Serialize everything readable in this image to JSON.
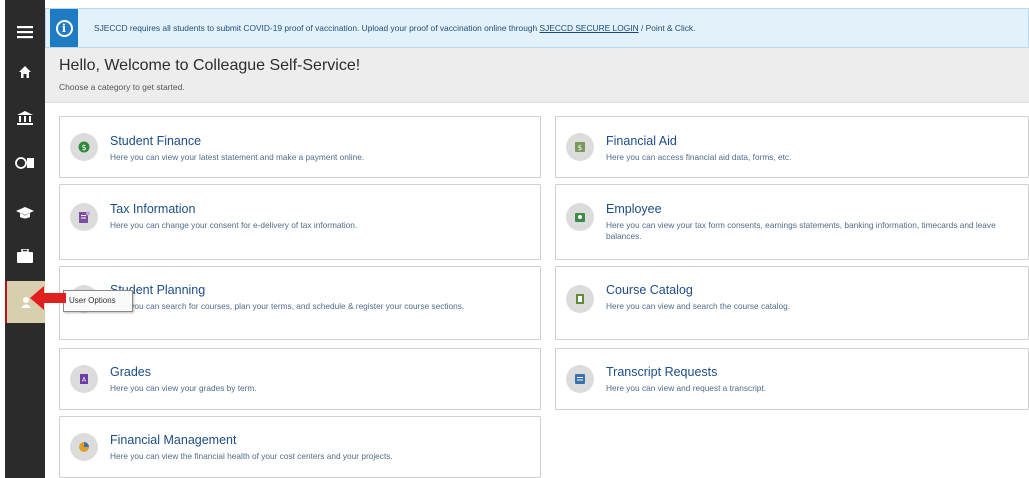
{
  "banner": {
    "text_before": "SJECCD requires all students to submit COVID-19 proof of vaccination. Upload your proof of vaccination online through ",
    "link": "SJECCD SECURE LOGIN",
    "text_after": " / Point & Click."
  },
  "header": {
    "title": "Hello, Welcome to Colleague Self-Service!",
    "subtitle": "Choose a category to get started."
  },
  "sidebar": {
    "items": [
      {
        "icon": "hamburger-menu-icon"
      },
      {
        "icon": "home-icon"
      },
      {
        "icon": "bank-icon"
      },
      {
        "icon": "financial-aid-icon"
      },
      {
        "icon": "graduation-cap-icon"
      },
      {
        "icon": "briefcase-icon"
      },
      {
        "icon": "user-options-icon"
      }
    ]
  },
  "tooltip": "User Options",
  "cards": [
    {
      "title": "Student Finance",
      "desc": "Here you can view your latest statement and make a payment online.",
      "icon": "dollar-circle-icon",
      "color": "#2e8b3e"
    },
    {
      "title": "Financial Aid",
      "desc": "Here you can access financial aid data, forms, etc.",
      "icon": "money-icon",
      "color": "#7a9a5c"
    },
    {
      "title": "Tax Information",
      "desc": "Here you can change your consent for e-delivery of tax information.",
      "icon": "tax-document-icon",
      "color": "#7b4fa3"
    },
    {
      "title": "Employee",
      "desc": "Here you can view your tax form consents, earnings statements, banking information, timecards and leave balances.",
      "icon": "employee-badge-icon",
      "color": "#3e8a4a"
    },
    {
      "title": "Student Planning",
      "desc": "Here you can search for courses, plan your terms, and schedule & register your course sections.",
      "icon": "planning-icon",
      "color": "#5a6b8a"
    },
    {
      "title": "Course Catalog",
      "desc": "Here you can view and search the course catalog.",
      "icon": "book-icon",
      "color": "#5f8a3a"
    },
    {
      "title": "Grades",
      "desc": "Here you can view your grades by term.",
      "icon": "grades-icon",
      "color": "#6b3fa0"
    },
    {
      "title": "Transcript Requests",
      "desc": "Here you can view and request a transcript.",
      "icon": "transcript-icon",
      "color": "#3a72b0"
    },
    {
      "title": "Financial Management",
      "desc": "Here you can view the financial health of your cost centers and your projects.",
      "icon": "pie-chart-icon",
      "color": "#e0a12a"
    }
  ]
}
